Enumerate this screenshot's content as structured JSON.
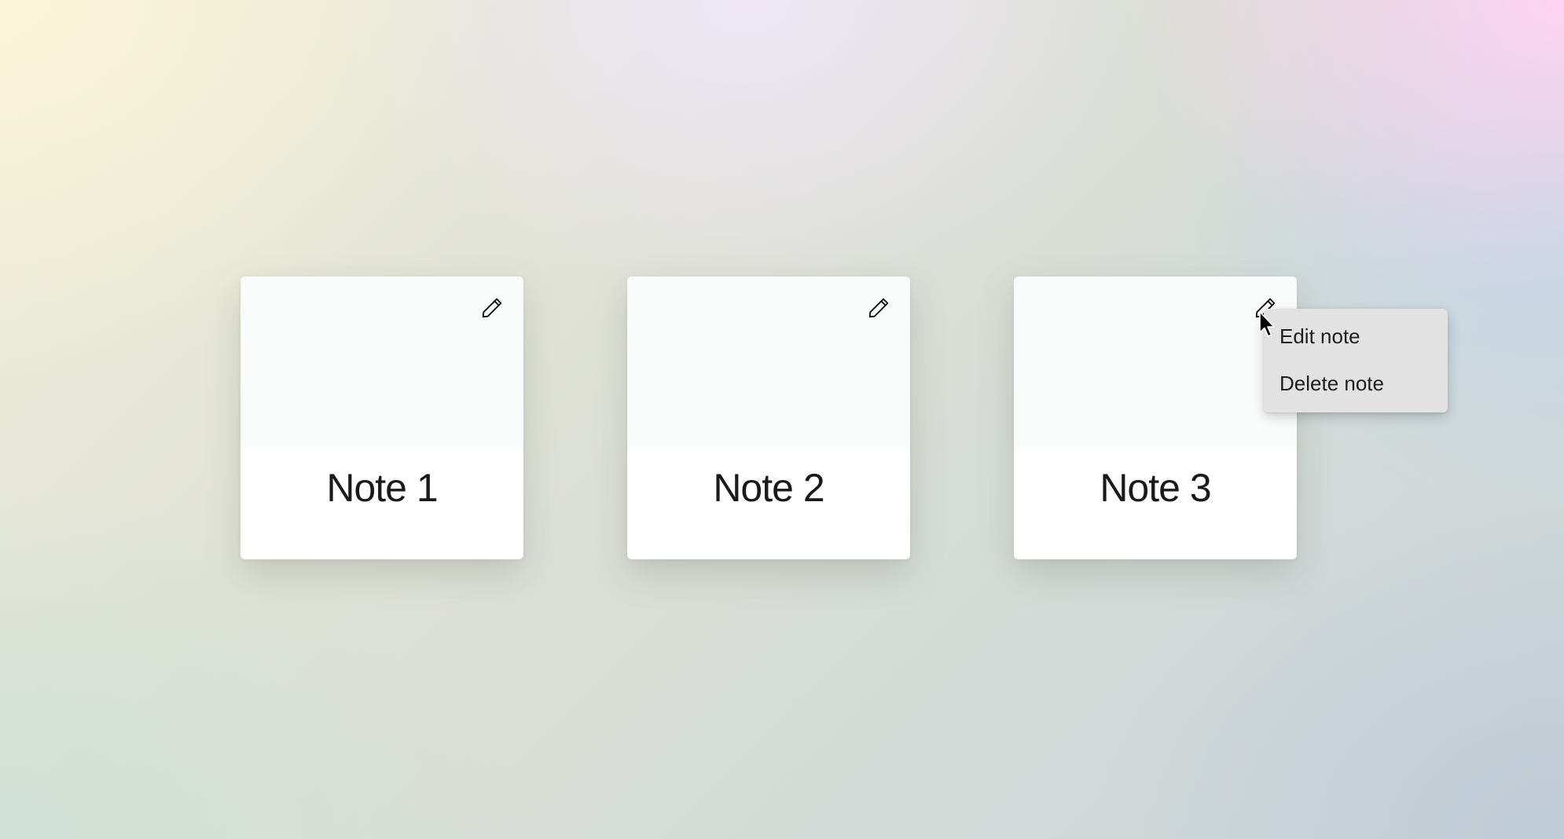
{
  "notes": [
    {
      "title": "Note 1",
      "edit_icon": "pencil-icon"
    },
    {
      "title": "Note 2",
      "edit_icon": "pencil-icon"
    },
    {
      "title": "Note 3",
      "edit_icon": "pencil-icon"
    }
  ],
  "context_menu": {
    "items": [
      {
        "label": "Edit note"
      },
      {
        "label": "Delete note"
      }
    ]
  },
  "colors": {
    "card_background": "#ffffff",
    "card_top_background": "#fafcfb",
    "menu_background": "#e2e2e2",
    "text": "#1a1a1a"
  }
}
